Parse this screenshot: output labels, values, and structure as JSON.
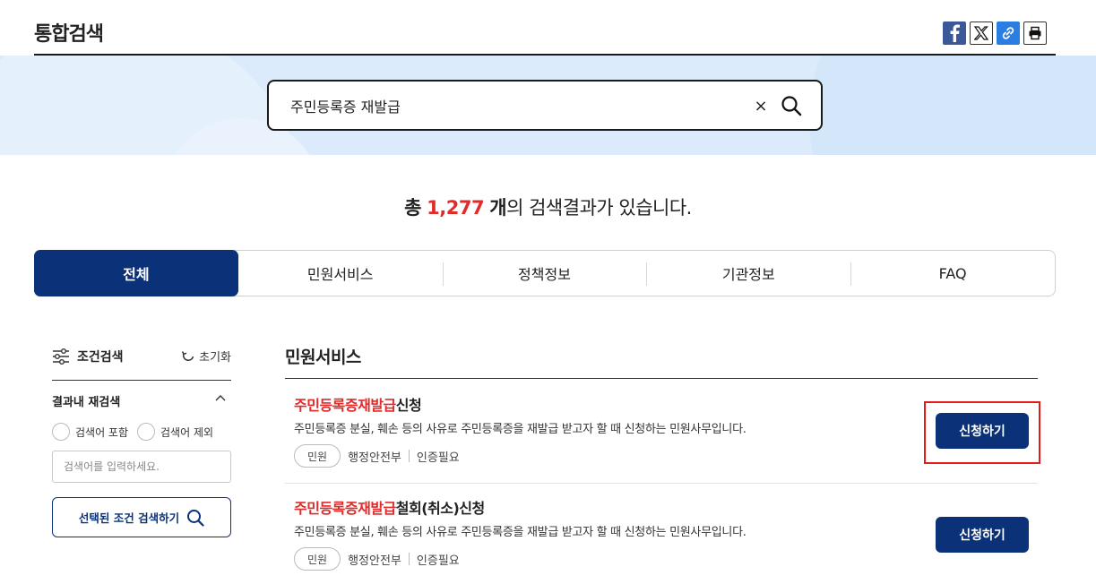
{
  "header": {
    "title": "통합검색",
    "share": {
      "facebook": "facebook-icon",
      "x": "x-icon",
      "link": "link-icon",
      "print": "print-icon"
    }
  },
  "search": {
    "value": "주민등록증 재발급",
    "clear_label": "×"
  },
  "summary": {
    "prefix": "총",
    "count": "1,277",
    "unit": "개",
    "suffix": "의 검색결과가 있습니다."
  },
  "tabs": [
    {
      "label": "전체",
      "active": true
    },
    {
      "label": "민원서비스",
      "active": false
    },
    {
      "label": "정책정보",
      "active": false
    },
    {
      "label": "기관정보",
      "active": false
    },
    {
      "label": "FAQ",
      "active": false
    }
  ],
  "sidebar": {
    "filter_title": "조건검색",
    "reset_label": "초기화",
    "refine_title": "결과내 재검색",
    "radio_include": "검색어 포함",
    "radio_exclude": "검색어 제외",
    "input_placeholder": "검색어를 입력하세요.",
    "apply_label": "선택된 조건 검색하기"
  },
  "results": {
    "section_title": "민원서비스",
    "items": [
      {
        "title_highlight": "주민등록증재발급",
        "title_rest": "신청",
        "description": "주민등록증 분실, 훼손 등의 사유로 주민등록증을 재발급 받고자 할 때 신청하는 민원사무입니다.",
        "badge": "민원",
        "agency": "행정안전부",
        "auth": "인증필요",
        "button": "신청하기"
      },
      {
        "title_highlight": "주민등록증재발급",
        "title_rest": "철회(취소)신청",
        "description": "주민등록증 분실, 훼손 등의 사유로 주민등록증을 재발급 받고자 할 때 신청하는 민원사무입니다.",
        "badge": "민원",
        "agency": "행정안전부",
        "auth": "인증필요",
        "button": "신청하기"
      }
    ]
  },
  "colors": {
    "primary": "#0b3278",
    "highlight": "#e02b2b",
    "banner": "#dcebfb"
  }
}
